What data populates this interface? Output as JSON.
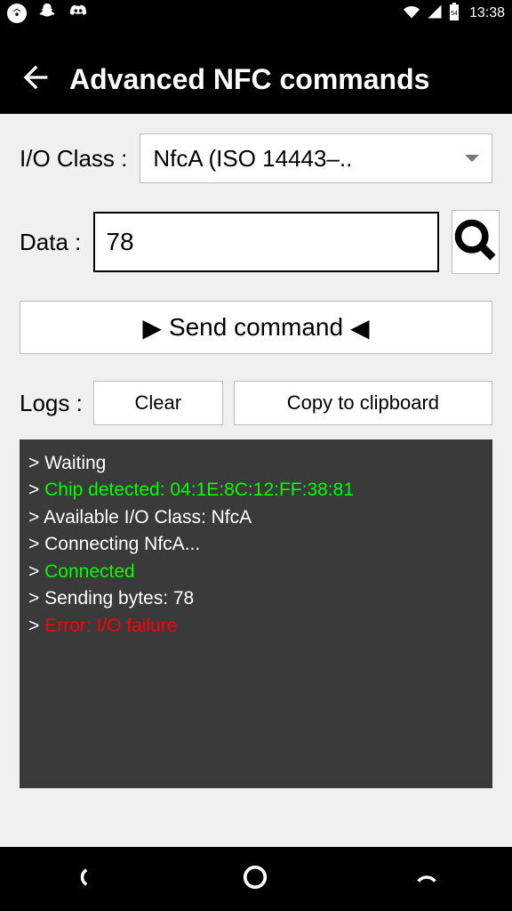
{
  "status_bar": {
    "time": "13:38",
    "battery_label": "54"
  },
  "header": {
    "title": "Advanced NFC commands"
  },
  "form": {
    "io_class_label": "I/O Class :",
    "io_class_value": "NfcA (ISO 14443–..",
    "data_label": "Data :",
    "data_value": "78",
    "send_label": "Send command"
  },
  "logs_section": {
    "label": "Logs :",
    "clear_label": "Clear",
    "copy_label": "Copy to clipboard"
  },
  "log_lines": [
    {
      "text": "Waiting",
      "color": "white"
    },
    {
      "text": "Chip detected: 04:1E:8C:12:FF:38:81",
      "color": "green"
    },
    {
      "text": "Available I/O Class: NfcA",
      "color": "white"
    },
    {
      "text": "Connecting NfcA...",
      "color": "white"
    },
    {
      "text": "Connected",
      "color": "green"
    },
    {
      "text": "Sending bytes: 78",
      "color": "white"
    },
    {
      "text": "Error: I/O failure",
      "color": "red"
    }
  ]
}
